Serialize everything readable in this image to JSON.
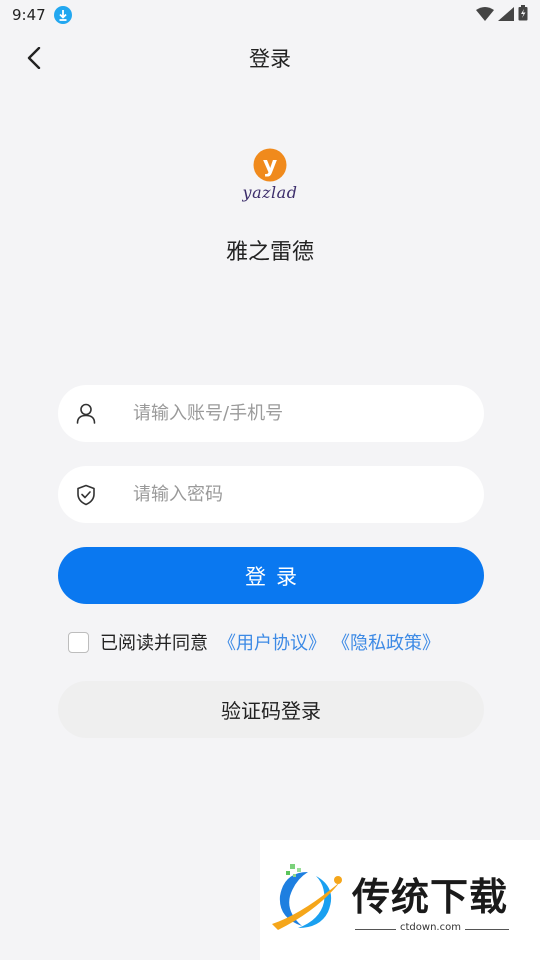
{
  "status_bar": {
    "time": "9:47",
    "icons": [
      "download-icon",
      "wifi-icon",
      "cellular-signal-icon",
      "battery-icon"
    ]
  },
  "header": {
    "title": "登录",
    "back_icon": "chevron-left-icon"
  },
  "brand": {
    "logo_letter": "y",
    "logo_word": "yazlad",
    "app_name": "雅之雷德",
    "logo_color": "#f08a1c",
    "logo_word_color": "#3c2d6b"
  },
  "form": {
    "account": {
      "placeholder": "请输入账号/手机号",
      "value": "",
      "icon": "user-icon"
    },
    "password": {
      "placeholder": "请输入密码",
      "value": "",
      "icon": "shield-check-icon"
    },
    "login_button": "登录",
    "agreement": {
      "checked": false,
      "text": "已阅读并同意",
      "user_agreement": "《用户协议》",
      "privacy_policy": "《隐私政策》"
    },
    "sms_login_button": "验证码登录"
  },
  "watermark": {
    "text": "传统下载",
    "sub": "ctdown.com"
  },
  "colors": {
    "accent": "#0a78f0",
    "link": "#3d8ae5",
    "background": "#f4f4f6"
  }
}
